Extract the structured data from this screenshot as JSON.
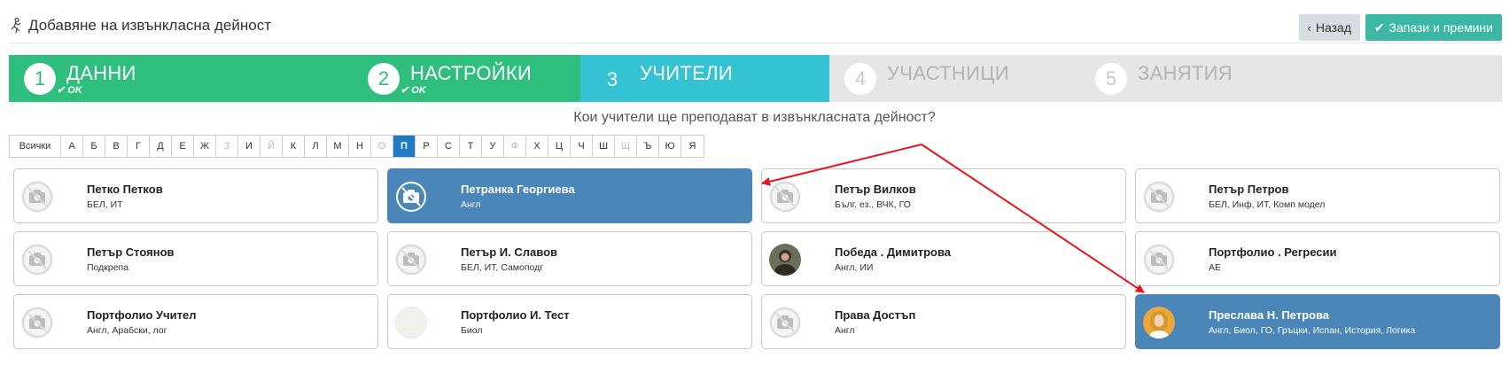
{
  "header": {
    "title": "Добавяне на извънкласна дейност",
    "back_label": "Назад",
    "save_label": "Запази и премини"
  },
  "steps": [
    {
      "num": "1",
      "label": "ДАННИ",
      "status": "done",
      "ok": "OK"
    },
    {
      "num": "2",
      "label": "НАСТРОЙКИ",
      "status": "done",
      "ok": "OK"
    },
    {
      "num": "3",
      "label": "УЧИТЕЛИ",
      "status": "active"
    },
    {
      "num": "4",
      "label": "УЧАСТНИЦИ",
      "status": "todo"
    },
    {
      "num": "5",
      "label": "ЗАНЯТИЯ",
      "status": "todo"
    }
  ],
  "question": "Кои учители ще преподават в извънкласната дейност?",
  "letters": {
    "all": "Всички",
    "items": [
      "А",
      "Б",
      "В",
      "Г",
      "Д",
      "Е",
      "Ж",
      "З",
      "И",
      "Й",
      "К",
      "Л",
      "М",
      "Н",
      "О",
      "П",
      "Р",
      "С",
      "Т",
      "У",
      "Ф",
      "Х",
      "Ц",
      "Ч",
      "Ш",
      "Щ",
      "Ъ",
      "Ю",
      "Я"
    ],
    "active": "П",
    "disabled": [
      "З",
      "Й",
      "О",
      "Ф",
      "Щ"
    ]
  },
  "teachers": [
    {
      "name": "Петко Петков",
      "subjects": "БЕЛ, ИТ",
      "avatar": "camera-placeholder",
      "selected": false
    },
    {
      "name": "Петранка Георгиева",
      "subjects": "Англ",
      "avatar": "camera-placeholder",
      "selected": true
    },
    {
      "name": "Петър Вилков",
      "subjects": "Бълг. ез., ВЧК, ГО",
      "avatar": "camera-placeholder",
      "selected": false
    },
    {
      "name": "Петър Петров",
      "subjects": "БЕЛ, Инф, ИТ, Комп модел",
      "avatar": "camera-placeholder",
      "selected": false
    },
    {
      "name": "Петър Стоянов",
      "subjects": "Подкрепа",
      "avatar": "camera-placeholder",
      "selected": false
    },
    {
      "name": "Петър И. Славов",
      "subjects": "БЕЛ, ИТ, Самоподг",
      "avatar": "camera-placeholder",
      "selected": false
    },
    {
      "name": "Победа . Димитрова",
      "subjects": "Англ, ИИ",
      "avatar": "photo-dark",
      "selected": false
    },
    {
      "name": "Портфолио . Регресии",
      "subjects": "АЕ",
      "avatar": "camera-placeholder",
      "selected": false
    },
    {
      "name": "Портфолио Учител",
      "subjects": "Англ, Арабски, лог",
      "avatar": "camera-placeholder",
      "selected": false
    },
    {
      "name": "Портфолио И. Тест",
      "subjects": "Биол",
      "avatar": "photo-light",
      "selected": false
    },
    {
      "name": "Права Достъп",
      "subjects": "Англ",
      "avatar": "camera-placeholder",
      "selected": false
    },
    {
      "name": "Преслава Н. Петрова",
      "subjects": "Англ, Биол, ГО, Гръцки, Испан, История, Логика",
      "avatar": "photo-blonde",
      "selected": true
    }
  ],
  "colors": {
    "done": "#2ebf7e",
    "active_step": "#33c3d2",
    "selected_card": "#4b86b8",
    "active_letter": "#1f7bc4",
    "save_button": "#3cb6a5",
    "annotation_arrow": "#e8161b"
  }
}
